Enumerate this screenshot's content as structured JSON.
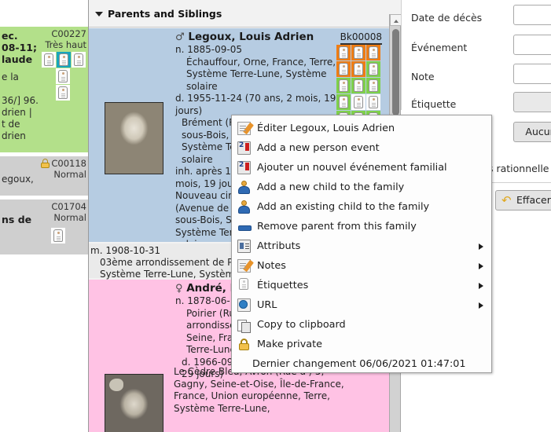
{
  "left_list": {
    "rows": [
      {
        "bg": "green",
        "lines": [
          "ec.",
          "08-11;",
          "laude"
        ],
        "plain": [
          "e la",
          "",
          "36/] 96.",
          "drien |",
          "t de",
          "drien"
        ],
        "code": "C00227",
        "privacy": "Très haut",
        "locked": false,
        "tags_row1": [
          "white",
          "teal",
          "white"
        ],
        "tags_row2": [
          "white",
          "white"
        ]
      },
      {
        "bg": "grey",
        "lines": [],
        "plain": [
          "egoux,"
        ],
        "code": "C00118",
        "privacy": "Normal",
        "locked": true,
        "tags_row1": [],
        "tags_row2": []
      },
      {
        "bg": "grey",
        "lines": [
          "ns de"
        ],
        "plain": [],
        "code": "C01704",
        "privacy": "Normal",
        "locked": false,
        "tags_row1": [
          "white"
        ],
        "tags_row2": []
      }
    ]
  },
  "center": {
    "section_header": "Parents and Siblings",
    "person1": {
      "sex_symbol": "♂",
      "name": "Legoux, Louis Adrien",
      "code": "Bk00008",
      "birth": "n. 1885-09-05",
      "birth_place": "Échauffour, Orne, France, Terre, Système Terre-Lune, Système solaire",
      "death": "d. 1955-11-24 (70 ans, 2 mois, 19 jours)",
      "death_place": "Brément (Rue du) 11, Montreuil-sous-Bois, Seine, France, Terre, Système Terre-Lune, Système solaire",
      "burial": "inh. après 1955-11-24 (70 ans, 2 mois, 19 jours)",
      "burial_place": "Nouveau cimetière, Vincennes (Avenue de la) 33, Montreuil-sous-Bois, Seine, France, Terre, Système Terre-Lune, Système solaire",
      "tag_rows": [
        [
          "orange",
          "orange",
          "orange"
        ],
        [
          "orange",
          "orange",
          "green"
        ],
        [
          "green",
          "green",
          "green"
        ],
        [
          "green",
          "white",
          "white"
        ],
        [
          "green",
          "green",
          "green"
        ]
      ]
    },
    "family": {
      "marriage": "m. 1908-10-31",
      "marriage_place": "03ème arrondissement de Paris, Paris, Seine, France, Terre, Système Terre-Lune, Système solaire"
    },
    "person2": {
      "sex_symbol": "♀",
      "name": "André, Blanche Marie",
      "birth": "n. 1878-06-14",
      "birth_place": "Poirier (Rue du) 4, 03ème arrondissement de Paris, Paris, Seine, France, Terre, Système Terre-Lune, Système solaire",
      "death": "d. 1966-09-12 (88 ans, 2 mois, 29 jours)",
      "death_place": "Le Cèdre Bleu, Avron (Rue d') 5, Gagny, Seine-et-Oise, Île-de-France, France, Union européenne, Terre, Système Terre-Lune,"
    }
  },
  "context_menu": {
    "items": [
      {
        "icon": "edit-icon",
        "label": "Éditer Legoux, Louis Adrien",
        "submenu": false
      },
      {
        "icon": "add-person-event-icon",
        "label": "Add a new person event",
        "submenu": false
      },
      {
        "icon": "add-family-event-icon",
        "label": "Ajouter un nouvel événement familial",
        "submenu": false
      },
      {
        "icon": "person-icon",
        "label": "Add a new child to the family",
        "submenu": false
      },
      {
        "icon": "person-icon",
        "label": "Add an existing child to the family",
        "submenu": false
      },
      {
        "icon": "remove-icon",
        "label": "Remove parent from this family",
        "submenu": false
      },
      {
        "icon": "attributes-icon",
        "label": "Attributs",
        "submenu": true
      },
      {
        "icon": "notes-icon",
        "label": "Notes",
        "submenu": true
      },
      {
        "icon": "tag-icon",
        "label": "Étiquettes",
        "submenu": true
      },
      {
        "icon": "url-icon",
        "label": "URL",
        "submenu": true
      },
      {
        "icon": "copy-icon",
        "label": "Copy to clipboard",
        "submenu": false
      },
      {
        "icon": "lock-icon",
        "label": "Make private",
        "submenu": false
      },
      {
        "icon": "none",
        "label": "Dernier changement 06/06/2021 01:47:01",
        "submenu": false
      }
    ]
  },
  "right_panel": {
    "fields": [
      {
        "label": "Date de décès",
        "value": "",
        "type": "input"
      },
      {
        "label": "Événement",
        "value": "",
        "type": "input"
      },
      {
        "label": "Note",
        "value": "",
        "type": "input"
      },
      {
        "label": "Étiquette",
        "value": "",
        "type": "select"
      }
    ],
    "none_button": "Aucun",
    "rationale_text": "s rationnelle",
    "clear_button": "Effacer"
  },
  "colors": {
    "tag_orange": "#f07d13",
    "tag_green": "#7fd14a",
    "tag_teal": "#17a5bd",
    "row_blue": "#b6cce2",
    "row_pink": "#ffc2e4",
    "row_green": "#b3e08a",
    "row_grey": "#cfcfcf"
  }
}
